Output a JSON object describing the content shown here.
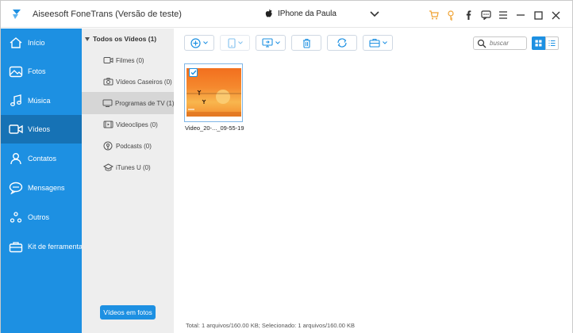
{
  "app": {
    "title": "Aiseesoft FoneTrans (Versão de teste)",
    "device_name": "IPhone da Paula",
    "accent_color": "#1d90e2",
    "titlebar_icons": [
      "cart-icon",
      "key-icon",
      "facebook-icon",
      "chat-icon",
      "menu-icon",
      "minimize-icon",
      "maximize-icon",
      "close-icon"
    ]
  },
  "sidebar": {
    "items": [
      {
        "label": "Início",
        "icon": "home-icon"
      },
      {
        "label": "Fotos",
        "icon": "photos-icon"
      },
      {
        "label": "Música",
        "icon": "music-icon"
      },
      {
        "label": "Vídeos",
        "icon": "video-icon",
        "active": true
      },
      {
        "label": "Contatos",
        "icon": "contacts-icon"
      },
      {
        "label": "Mensagens",
        "icon": "messages-icon"
      },
      {
        "label": "Outros",
        "icon": "others-icon"
      },
      {
        "label": "Kit de ferramentas",
        "icon": "toolbox-icon"
      }
    ]
  },
  "categories": {
    "root_label": "Todos os Vídeos (1)",
    "items": [
      {
        "label": "Filmes (0)",
        "icon": "film-icon"
      },
      {
        "label": "Vídeos Caseiros (0)",
        "icon": "camera-icon"
      },
      {
        "label": "Programas de TV (1)",
        "icon": "tv-icon",
        "active": true
      },
      {
        "label": "Videoclipes (0)",
        "icon": "clip-icon"
      },
      {
        "label": "Podcasts (0)",
        "icon": "podcast-icon"
      },
      {
        "label": "iTunes U (0)",
        "icon": "itunes-u-icon"
      }
    ],
    "convert_button": "Vídeos em fotos"
  },
  "toolbar": {
    "buttons": [
      "add-icon",
      "export-device-icon",
      "export-pc-icon",
      "delete-icon",
      "refresh-icon",
      "toolbox-icon"
    ],
    "search_placeholder": "buscar"
  },
  "files": [
    {
      "caption": "Video_20-..._09-55-19",
      "selected": true
    }
  ],
  "status": {
    "text": "Total: 1 arquivos/160.00 KB; Selecionado: 1 arquivos/160.00 KB"
  }
}
